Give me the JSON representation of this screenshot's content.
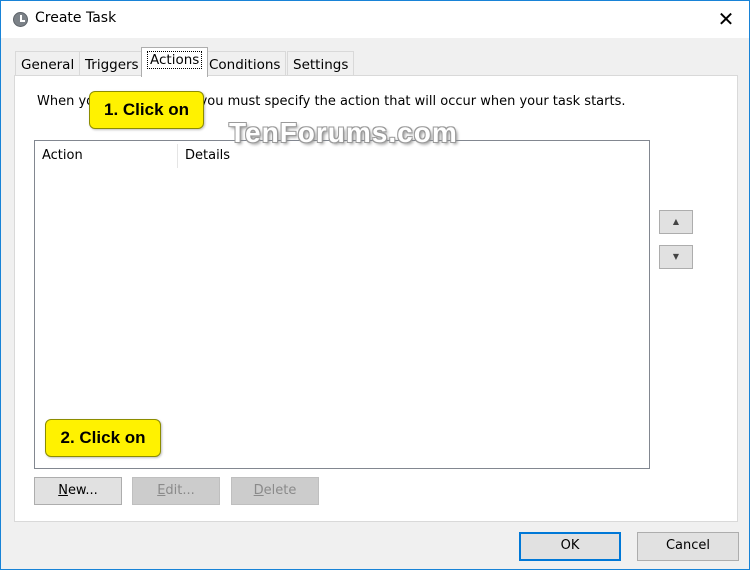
{
  "window": {
    "title": "Create Task"
  },
  "tabs": [
    {
      "label": "General"
    },
    {
      "label": "Triggers"
    },
    {
      "label": "Actions"
    },
    {
      "label": "Conditions"
    },
    {
      "label": "Settings"
    }
  ],
  "intro_text": "When you create a task, you must specify the action that will occur when your task starts.",
  "list": {
    "columns": [
      "Action",
      "Details"
    ]
  },
  "buttons": {
    "new": {
      "u": "N",
      "rest": "ew..."
    },
    "edit": {
      "u": "E",
      "rest": "dit..."
    },
    "delete": {
      "u": "D",
      "rest": "elete"
    },
    "ok": "OK",
    "cancel": "Cancel"
  },
  "callouts": {
    "first": "1. Click on",
    "second": "2. Click on"
  },
  "watermark": "TenForums.com",
  "colors": {
    "accent": "#0078d7",
    "callout": "#fff200",
    "window_border": "#1883d7"
  }
}
